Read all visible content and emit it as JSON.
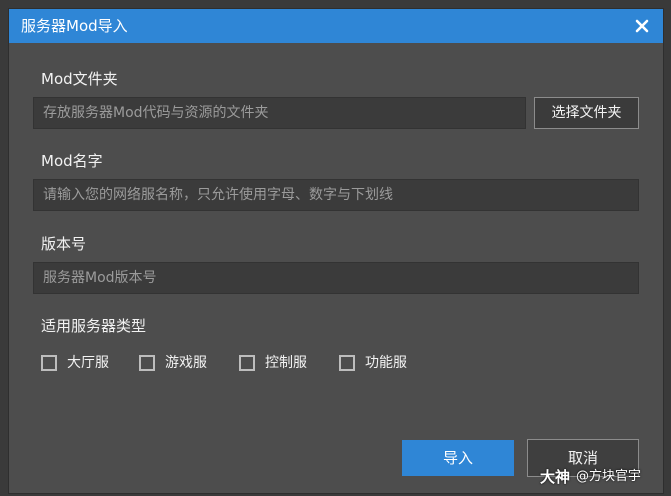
{
  "dialog": {
    "title": "服务器Mod导入"
  },
  "folder": {
    "label": "Mod文件夹",
    "placeholder": "存放服务器Mod代码与资源的文件夹",
    "browse_label": "选择文件夹"
  },
  "name": {
    "label": "Mod名字",
    "placeholder": "请输入您的网络服名称，只允许使用字母、数字与下划线"
  },
  "version": {
    "label": "版本号",
    "placeholder": "服务器Mod版本号"
  },
  "server_types": {
    "label": "适用服务器类型",
    "options": [
      {
        "label": "大厅服",
        "checked": false
      },
      {
        "label": "游戏服",
        "checked": false
      },
      {
        "label": "控制服",
        "checked": false
      },
      {
        "label": "功能服",
        "checked": false
      }
    ]
  },
  "actions": {
    "import_label": "导入",
    "cancel_label": "取消"
  },
  "watermark": {
    "logo": "大神",
    "text": "@方块官宇"
  },
  "colors": {
    "accent": "#2f86d6",
    "dialog_bg": "#4d4d4d",
    "field_bg": "#3b3b3b"
  }
}
